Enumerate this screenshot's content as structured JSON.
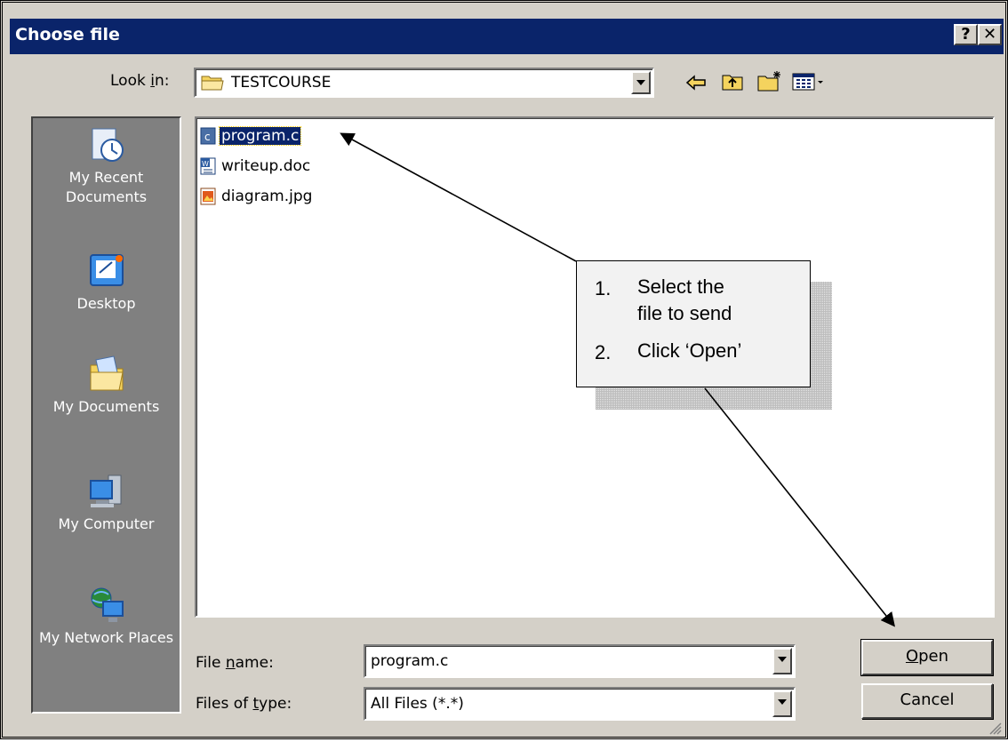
{
  "window": {
    "title": "Choose file",
    "help_label": "?",
    "close_label": "✕"
  },
  "lookin": {
    "label": "Look in:",
    "value": "TESTCOURSE"
  },
  "toolbar": {
    "back_icon": "back-arrow-icon",
    "up_icon": "up-folder-icon",
    "new_icon": "new-folder-icon",
    "views_icon": "views-menu-icon"
  },
  "places": [
    {
      "label": "My Recent Documents",
      "icon": "recent-documents-icon"
    },
    {
      "label": "Desktop",
      "icon": "desktop-icon"
    },
    {
      "label": "My Documents",
      "icon": "my-documents-icon"
    },
    {
      "label": "My Computer",
      "icon": "my-computer-icon"
    },
    {
      "label": "My Network Places",
      "icon": "network-places-icon"
    }
  ],
  "files": [
    {
      "name": "program.c",
      "selected": true,
      "icon": "c-file-icon"
    },
    {
      "name": "writeup.doc",
      "selected": false,
      "icon": "word-doc-icon"
    },
    {
      "name": "diagram.jpg",
      "selected": false,
      "icon": "image-file-icon"
    }
  ],
  "filename": {
    "label": "File name:",
    "value": "program.c"
  },
  "filetype": {
    "label": "Files of type:",
    "value": "All Files (*.*)"
  },
  "buttons": {
    "open": "Open",
    "cancel": "Cancel"
  },
  "callout": {
    "step1_num": "1.",
    "step1_line1": "Select the",
    "step1_line2": "file to send",
    "step2_num": "2.",
    "step2_text": "Click ‘Open’"
  },
  "colors": {
    "titlebar": "#0a246a",
    "dialog": "#d4d0c8",
    "places_bar": "#808080",
    "selection": "#0a246a"
  }
}
